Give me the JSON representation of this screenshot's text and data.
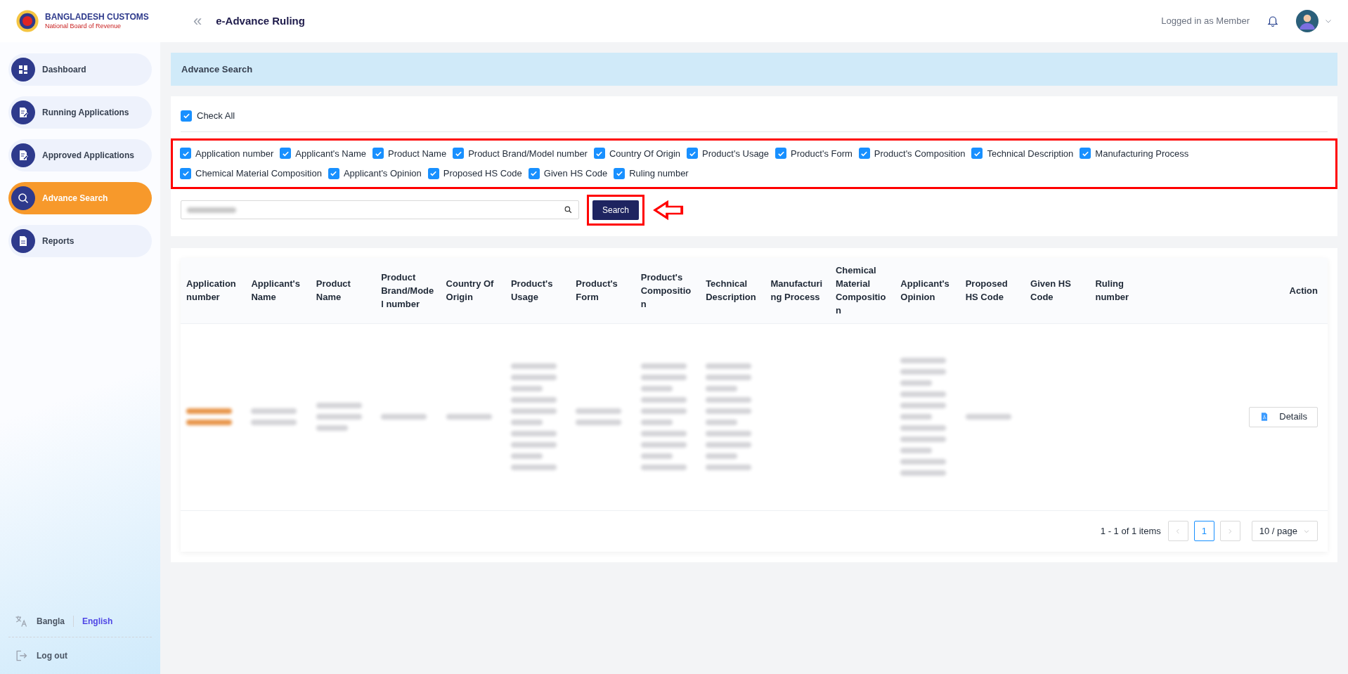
{
  "header": {
    "brand_title": "BANGLADESH CUSTOMS",
    "brand_subtitle": "National Board of Revenue",
    "collapse_glyph": "«",
    "app_title": "e-Advance Ruling",
    "user_label": "Logged in as Member"
  },
  "sidebar": {
    "items": [
      {
        "label": "Dashboard",
        "selected": false
      },
      {
        "label": "Running Applications",
        "selected": false
      },
      {
        "label": "Approved Applications",
        "selected": false
      },
      {
        "label": "Advance Search",
        "selected": true
      },
      {
        "label": "Reports",
        "selected": false
      }
    ],
    "languages": [
      {
        "label": "Bangla",
        "selected": false
      },
      {
        "label": "English",
        "selected": true
      }
    ],
    "logout": "Log out"
  },
  "page_title": "Advance Search",
  "check_all": {
    "label": "Check All",
    "checked": true
  },
  "fields_highlighted": true,
  "fields": [
    {
      "label": "Application number",
      "checked": true
    },
    {
      "label": "Applicant's Name",
      "checked": true
    },
    {
      "label": "Product Name",
      "checked": true
    },
    {
      "label": "Product Brand/Model number",
      "checked": true
    },
    {
      "label": "Country Of Origin",
      "checked": true
    },
    {
      "label": "Product's Usage",
      "checked": true
    },
    {
      "label": "Product's Form",
      "checked": true
    },
    {
      "label": "Product's Composition",
      "checked": true
    },
    {
      "label": "Technical Description",
      "checked": true
    },
    {
      "label": "Manufacturing Process",
      "checked": true
    },
    {
      "label": "Chemical Material Composition",
      "checked": true
    },
    {
      "label": "Applicant's Opinion",
      "checked": true
    },
    {
      "label": "Proposed HS Code",
      "checked": true
    },
    {
      "label": "Given HS Code",
      "checked": true
    },
    {
      "label": "Ruling number",
      "checked": true
    }
  ],
  "search": {
    "value_blurred": true,
    "button": "Search",
    "button_highlighted": true,
    "pointer_arrow": true
  },
  "table": {
    "columns": [
      "Application number",
      "Applicant's Name",
      "Product Name",
      "Product Brand/Model number",
      "Country Of Origin",
      "Product's Usage",
      "Product's Form",
      "Product's Composition",
      "Technical Description",
      "Manufacturing Process",
      "Chemical Material Composition",
      "Applicant's Opinion",
      "Proposed HS Code",
      "Given HS Code",
      "Ruling number",
      "Action"
    ],
    "rows": [
      {
        "cells": [
          {
            "kind": "blurred_accent"
          },
          {
            "kind": "blurred"
          },
          {
            "kind": "blurred"
          },
          {
            "kind": "blurred"
          },
          {
            "kind": "blurred"
          },
          {
            "kind": "blurred"
          },
          {
            "kind": "blurred"
          },
          {
            "kind": "blurred"
          },
          {
            "kind": "blurred"
          },
          {
            "kind": "empty"
          },
          {
            "kind": "empty"
          },
          {
            "kind": "blurred"
          },
          {
            "kind": "blurred"
          },
          {
            "kind": "empty"
          },
          {
            "kind": "empty"
          },
          {
            "kind": "action",
            "label": "Details"
          }
        ]
      }
    ]
  },
  "pagination": {
    "summary": "1 - 1 of 1 items",
    "pages": [
      {
        "label": "1",
        "selected": true
      }
    ],
    "prev_disabled": true,
    "next_disabled": true,
    "page_size": "10 / page"
  }
}
